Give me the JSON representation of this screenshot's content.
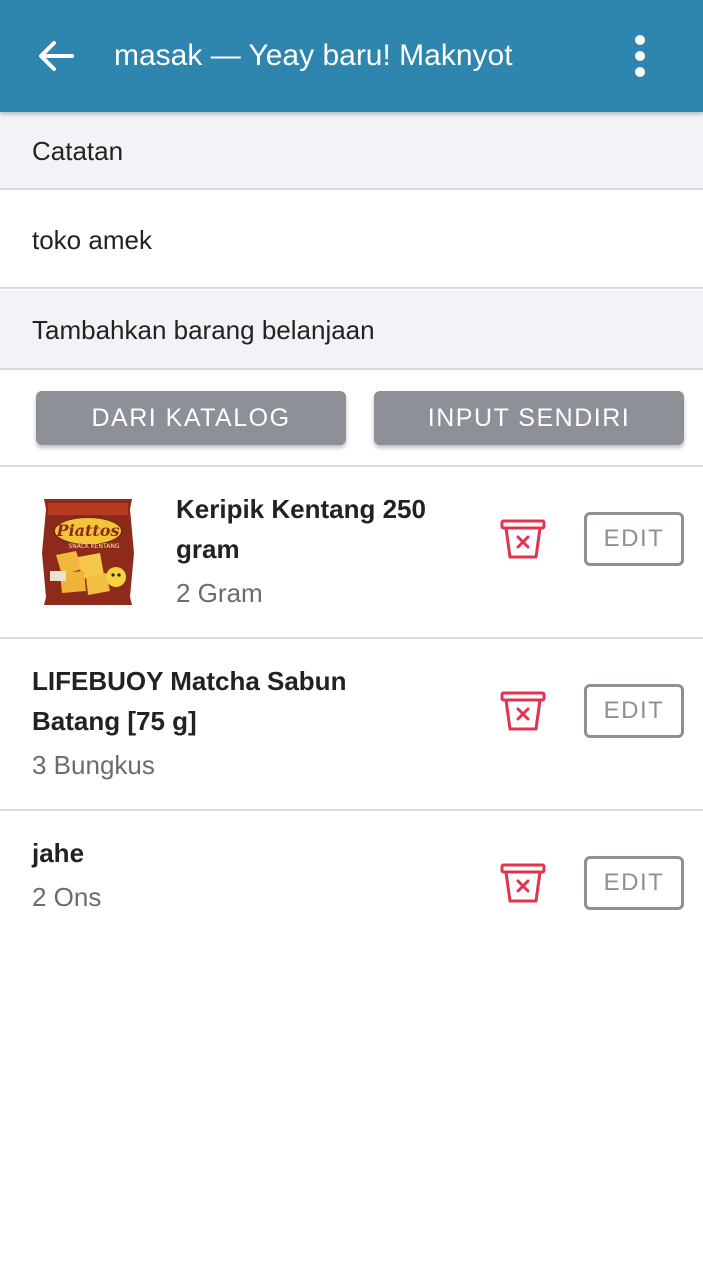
{
  "appbar": {
    "title": "masak — Yeay baru! Maknyot",
    "back_icon": "arrow-left-icon",
    "menu_icon": "more-vertical-icon"
  },
  "notes": {
    "header": "Catatan",
    "value": "toko amek"
  },
  "add_items": {
    "header": "Tambahkan barang belanjaan",
    "from_catalog_label": "DARI KATALOG",
    "manual_input_label": "INPUT SENDIRI"
  },
  "items": [
    {
      "name_line1": "Keripik Kentang 250",
      "name_line2": "gram",
      "quantity": "2 Gram",
      "thumbnail_brand": "Piattos",
      "thumbnail_sub": "SNACK KENTANG",
      "edit_label": "EDIT"
    },
    {
      "name_line1": "LIFEBUOY Matcha Sabun",
      "name_line2": "Batang [75 g]",
      "quantity": "3 Bungkus",
      "edit_label": "EDIT"
    },
    {
      "name_line1": "jahe",
      "quantity": "2 Ons",
      "edit_label": "EDIT"
    }
  ],
  "colors": {
    "appbar": "#2e86ae",
    "button_gray": "#8e9098",
    "delete_red": "#e0344e",
    "section_bg": "#f2f3f7"
  }
}
